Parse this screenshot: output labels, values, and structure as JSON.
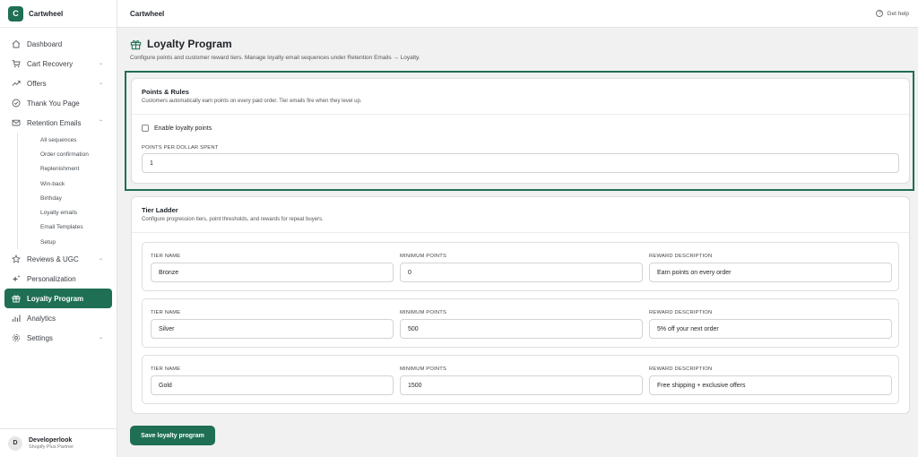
{
  "brand": {
    "initial": "C",
    "name": "Cartwheel"
  },
  "sidebar": {
    "items": [
      {
        "label": "Dashboard",
        "icon": "home-icon"
      },
      {
        "label": "Cart Recovery",
        "icon": "cart-icon",
        "chevron": true
      },
      {
        "label": "Offers",
        "icon": "trend-icon",
        "chevron": true
      },
      {
        "label": "Thank You Page",
        "icon": "check-circle-icon"
      },
      {
        "label": "Retention Emails",
        "icon": "mail-icon",
        "chevron": true,
        "expanded": true
      }
    ],
    "sub_items": [
      "All sequences",
      "Order confirmation",
      "Replenishment",
      "Win-back",
      "Birthday",
      "Loyalty emails",
      "Email Templates",
      "Setup"
    ],
    "items_after": [
      {
        "label": "Reviews & UGC",
        "icon": "star-icon",
        "chevron": true
      },
      {
        "label": "Personalization",
        "icon": "sparkle-icon"
      },
      {
        "label": "Loyalty Program",
        "icon": "gift-icon",
        "active": true
      },
      {
        "label": "Analytics",
        "icon": "bar-chart-icon"
      },
      {
        "label": "Settings",
        "icon": "gear-icon",
        "chevron": true
      }
    ],
    "footer": {
      "initial": "D",
      "name": "Developerlook",
      "role": "Shopify Plus Partner"
    }
  },
  "topbar": {
    "title": "Cartwheel",
    "help": "Get help"
  },
  "page": {
    "title": "Loyalty Program",
    "description": "Configure points and customer reward tiers. Manage loyalty email sequences under Retention Emails → Loyalty."
  },
  "points_rules": {
    "title": "Points & Rules",
    "description": "Customers automatically earn points on every paid order. Tier emails fire when they level up.",
    "enable_label": "Enable loyalty points",
    "enabled": false,
    "points_label": "POINTS PER DOLLAR SPENT",
    "points_value": "1"
  },
  "tier_ladder": {
    "title": "Tier Ladder",
    "description": "Configure progression tiers, point thresholds, and rewards for repeat buyers.",
    "labels": {
      "name": "TIER NAME",
      "min": "MINIMUM POINTS",
      "reward": "REWARD DESCRIPTION"
    },
    "tiers": [
      {
        "name": "Bronze",
        "min": "0",
        "reward": "Earn points on every order"
      },
      {
        "name": "Silver",
        "min": "500",
        "reward": "5% off your next order"
      },
      {
        "name": "Gold",
        "min": "1500",
        "reward": "Free shipping + exclusive offers"
      }
    ]
  },
  "save_label": "Save loyalty program",
  "colors": {
    "accent": "#1f6f54",
    "background": "#f1f1f1"
  }
}
